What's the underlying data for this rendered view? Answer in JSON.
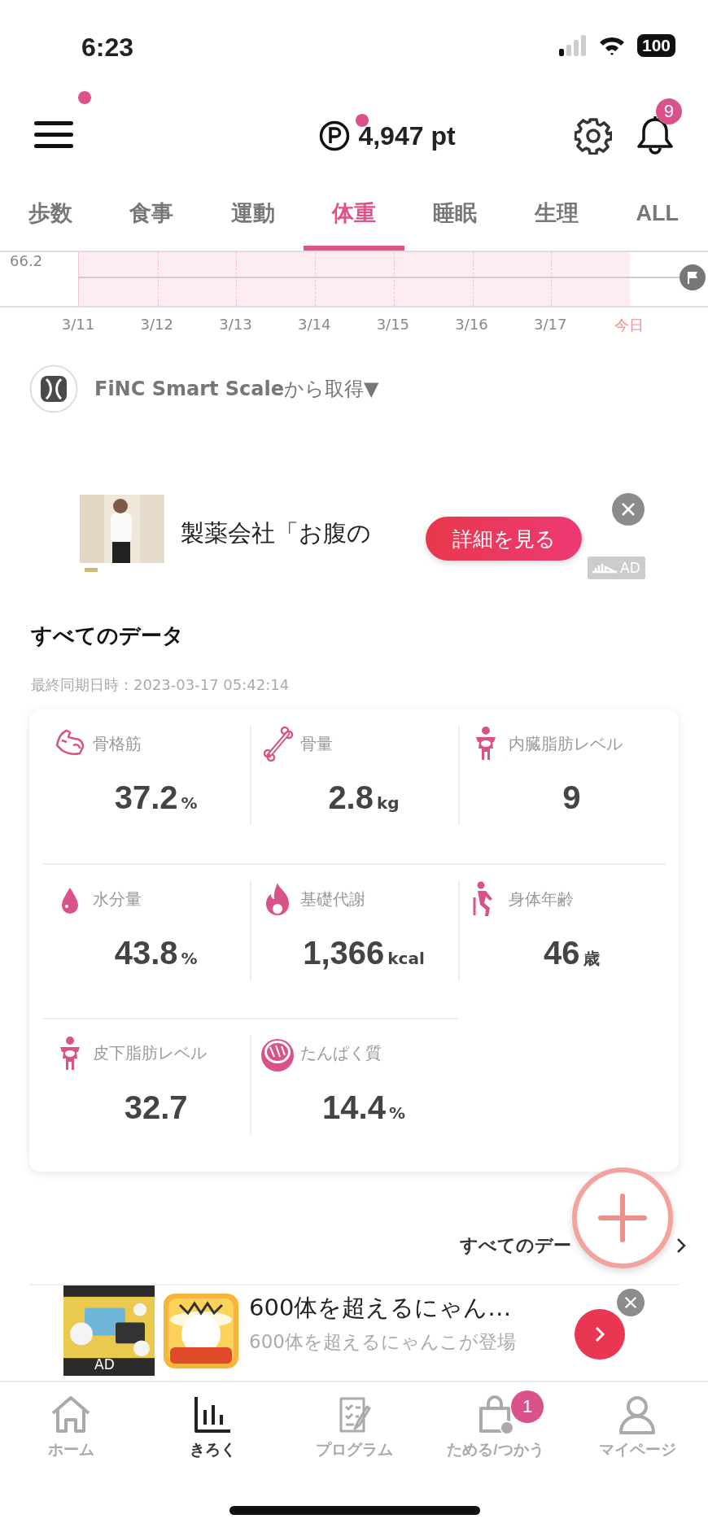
{
  "status_bar": {
    "time": "6:23",
    "battery": "100"
  },
  "header": {
    "menu_dot": true,
    "points_dot": true,
    "points": "4,947 pt",
    "notification_count": "9"
  },
  "tabs": [
    {
      "label": "歩数",
      "selected": false
    },
    {
      "label": "食事",
      "selected": false
    },
    {
      "label": "運動",
      "selected": false
    },
    {
      "label": "体重",
      "selected": true
    },
    {
      "label": "睡眠",
      "selected": false
    },
    {
      "label": "生理",
      "selected": false
    },
    {
      "label": "ALL",
      "selected": false
    }
  ],
  "chart": {
    "y_label": "66.2",
    "dates": [
      {
        "label": "3/11",
        "today": false
      },
      {
        "label": "3/12",
        "today": false
      },
      {
        "label": "3/13",
        "today": false
      },
      {
        "label": "3/14",
        "today": false
      },
      {
        "label": "3/15",
        "today": false
      },
      {
        "label": "3/16",
        "today": false
      },
      {
        "label": "3/17",
        "today": false
      },
      {
        "label": "今日",
        "today": true
      }
    ]
  },
  "source": "**FiNC Smart Scale**から取得▼",
  "ad_top": {
    "kind": "picture",
    "title": "製薬会社「お腹の",
    "button": "詳細を見る",
    "badge": "AD"
  },
  "section_title": "すべてのデータ",
  "last_sync": "最終同期日時：2023-03-17 05:42:14",
  "metrics": [
    {
      "label": "骨格筋",
      "value": "37.2",
      "unit": "%"
    },
    {
      "label": "骨量",
      "value": "2.8",
      "unit": "kg"
    },
    {
      "label": "内臓脂肪レベル",
      "value": "9"
    },
    {
      "label": "水分量",
      "value": "43.8",
      "unit": "%"
    },
    {
      "label": "基礎代謝",
      "value": "1,366",
      "unit": "kcal"
    },
    {
      "label": "身体年齢",
      "value": "46",
      "unit": "歳"
    },
    {
      "label": "皮下脂肪レベル",
      "value": "32.7"
    },
    {
      "label": "たんぱく質",
      "value": "14.4",
      "unit": "%"
    }
  ],
  "all_data_link": "すべてのデー",
  "ad_bottom": {
    "kind": "picture",
    "badge": "AD",
    "title": "600体を超えるにゃん…",
    "subtitle": "600体を超えるにゃんこが登場"
  },
  "bottom_nav": [
    {
      "label": "ホーム",
      "selected": false
    },
    {
      "label": "きろく",
      "selected": true
    },
    {
      "label": "プログラム",
      "selected": false
    },
    {
      "label": "ためる/つかう",
      "selected": false,
      "badge": "1"
    },
    {
      "label": "マイページ",
      "selected": false
    }
  ]
}
